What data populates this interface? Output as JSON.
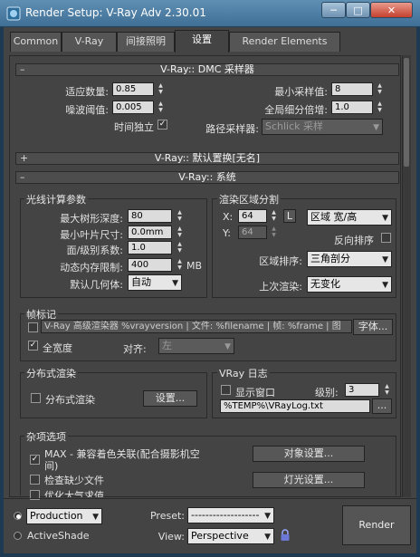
{
  "window": {
    "title": "Render Setup: V-Ray Adv 2.30.01",
    "min": "─",
    "max": "□",
    "close": "✕"
  },
  "tabs": [
    "Common",
    "V-Ray",
    "间接照明",
    "设置",
    "Render Elements"
  ],
  "dmc": {
    "header": "V-Ray:: DMC 采样器",
    "toggle": "–",
    "adaptive_label": "适应数量:",
    "adaptive_value": "0.85",
    "min_samples_label": "最小采样值:",
    "min_samples_value": "8",
    "noise_label": "噪波阈值:",
    "noise_value": "0.005",
    "global_subdiv_label": "全局细分倍增:",
    "global_subdiv_value": "1.0",
    "time_indep_label": "时间独立",
    "time_indep_checked": true,
    "path_sampler_label": "路径采样器:",
    "path_sampler_value": "Schlick 采样"
  },
  "displacement": {
    "header": "V-Ray:: 默认置换[无名]",
    "toggle": "+"
  },
  "system": {
    "header": "V-Ray:: 系统",
    "toggle": "–",
    "raycast": {
      "title": "光线计算参数",
      "max_tree_label": "最大树形深度:",
      "max_tree_value": "80",
      "min_leaf_label": "最小叶片尺寸:",
      "min_leaf_value": "0.0mm",
      "face_level_label": "面/级别系数:",
      "face_level_value": "1.0",
      "mem_limit_label": "动态内存限制:",
      "mem_limit_value": "400",
      "mem_unit": "MB",
      "default_geo_label": "默认几何体:",
      "default_geo_value": "自动"
    },
    "region": {
      "title": "渲染区域分割",
      "x_label": "X:",
      "x_value": "64",
      "lock_label": "L",
      "mode_value": "区域 宽/高",
      "y_label": "Y:",
      "y_value": "64",
      "reverse_label": "反向排序",
      "reverse_checked": false,
      "order_label": "区域排序:",
      "order_value": "三角剖分",
      "prev_label": "上次渲染:",
      "prev_value": "无变化"
    },
    "stamp": {
      "title": "帧标记",
      "stamp_checked": false,
      "stamp_text": "V-Ray 高级渲染器 %vrayversion | 文件: %filename | 帧: %frame | 图",
      "font_button": "字体...",
      "full_width_label": "全宽度",
      "full_width_checked": true,
      "align_label": "对齐:",
      "align_value": "左"
    },
    "distributed": {
      "title": "分布式渲染",
      "label": "分布式渲染",
      "checked": false,
      "settings_button": "设置..."
    },
    "log": {
      "title": "VRay 日志",
      "show_window_label": "显示窗口",
      "show_window_checked": false,
      "level_label": "级别:",
      "level_value": "3",
      "path_value": "%TEMP%\\VRayLog.txt",
      "browse_button": "..."
    },
    "misc": {
      "title": "杂项选项",
      "max_compat_label": "MAX - 兼容着色关联(配合摄影机空间)",
      "max_compat_checked": true,
      "check_missing_label": "检查缺少文件",
      "check_missing_checked": false,
      "optimize_atmo_label": "优化大气求值",
      "optimize_atmo_checked": false,
      "objects_button": "对象设置...",
      "lights_button": "灯光设置..."
    }
  },
  "footer": {
    "production_label": "Production",
    "production_selected": true,
    "activeshade_label": "ActiveShade",
    "preset_label": "Preset:",
    "preset_value": "-------------------",
    "view_label": "View:",
    "view_value": "Perspective",
    "render_button": "Render"
  }
}
